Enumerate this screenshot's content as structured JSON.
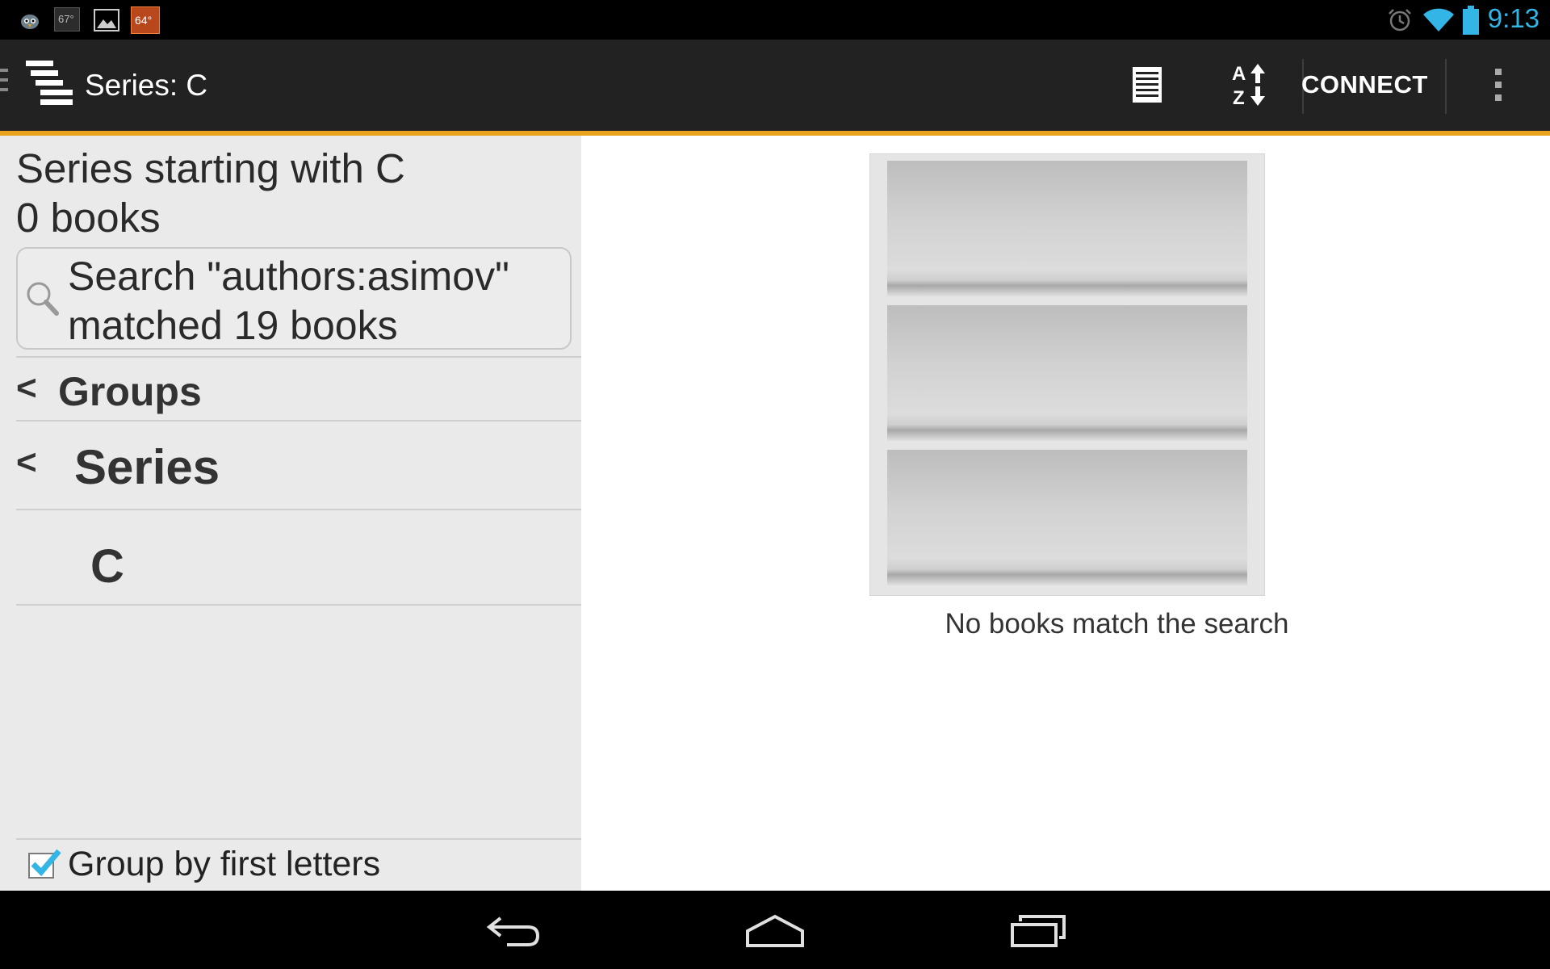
{
  "status_bar": {
    "time": "9:13",
    "left_icons": [
      "twitter-bird-icon",
      "weather-67-icon",
      "gallery-icon",
      "weather-64-icon"
    ],
    "weather_a": "67°",
    "weather_b": "64°",
    "right_icons": [
      "alarm-icon",
      "wifi-icon",
      "battery-icon"
    ]
  },
  "action_bar": {
    "title": "Series: C",
    "connect_label": "CONNECT",
    "accent_color": "#e8a21b",
    "icons": [
      "app-menu-icon",
      "list-view-icon",
      "sort-az-icon",
      "overflow-menu-icon"
    ]
  },
  "left_pane": {
    "header_line1": "Series starting with C",
    "header_line2": "0 books",
    "search_line1": "Search \"authors:asimov\"",
    "search_line2": "matched 19 books",
    "nav": [
      {
        "chevron": "<",
        "label": "Groups"
      },
      {
        "chevron": "<",
        "label": "Series"
      },
      {
        "label": "C"
      }
    ],
    "group_checkbox": {
      "label": "Group by first letters",
      "checked": true
    }
  },
  "right_pane": {
    "empty_message": "No books match the search"
  },
  "nav_bar": {
    "icons": [
      "back-icon",
      "home-icon",
      "recent-apps-icon"
    ]
  }
}
